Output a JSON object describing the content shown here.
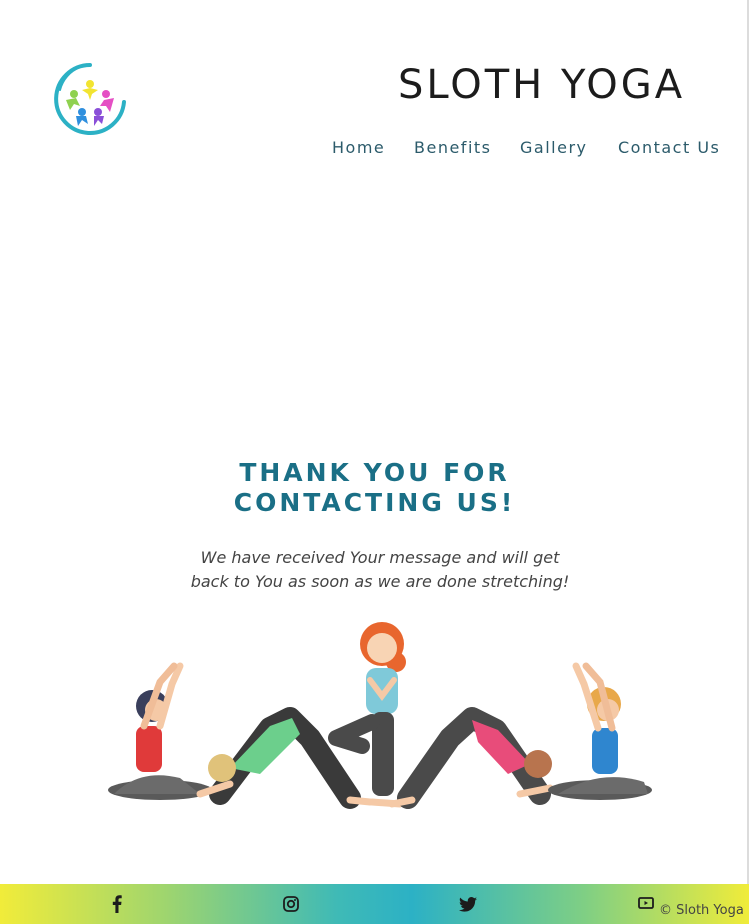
{
  "header": {
    "logo_icon": "yoga-people-circle-icon",
    "brand": "SLOTH YOGA"
  },
  "nav": {
    "items": [
      {
        "label": "Home"
      },
      {
        "label": "Benefits"
      },
      {
        "label": "Gallery"
      },
      {
        "label": "Contact Us"
      }
    ]
  },
  "main": {
    "title_line1": "THANK YOU FOR",
    "title_line2": "CONTACTING US!",
    "message_line1": "We have received Your message and will get",
    "message_line2": "back to You as soon as we are done stretching!",
    "illustration_icon": "yoga-group-illustration"
  },
  "footer": {
    "social": [
      {
        "icon": "facebook-icon"
      },
      {
        "icon": "instagram-icon"
      },
      {
        "icon": "twitter-icon"
      },
      {
        "icon": "youtube-icon"
      }
    ],
    "copyright": "© Sloth Yoga"
  },
  "colors": {
    "accent": "#1a6f86",
    "nav_text": "#2c5b6b",
    "brand_text": "#1c1c1c",
    "footer_gradient_start": "#f1ec3a",
    "footer_gradient_mid": "#2cb1c5"
  }
}
